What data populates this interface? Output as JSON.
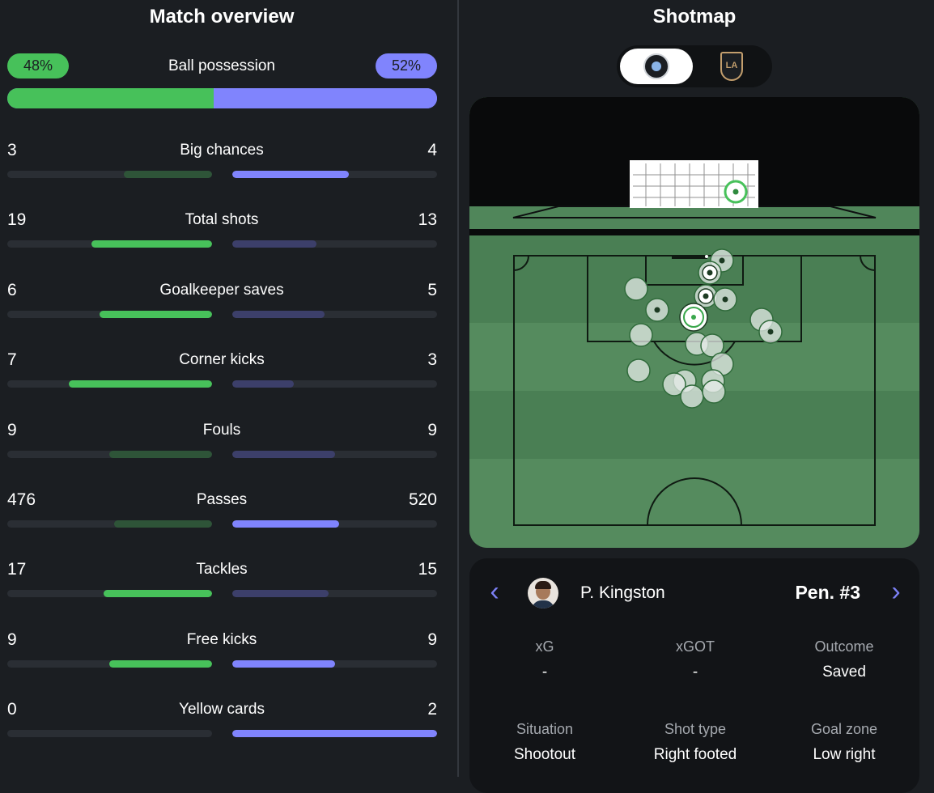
{
  "overview": {
    "title": "Match overview",
    "possession": {
      "label": "Ball possession",
      "home": "48%",
      "away": "52%",
      "home_fraction": 0.48
    },
    "stats": [
      {
        "label": "Big chances",
        "home": "3",
        "away": "4",
        "winner": "away",
        "home_fraction": 0.43,
        "away_fraction": 0.57
      },
      {
        "label": "Total shots",
        "home": "19",
        "away": "13",
        "winner": "home",
        "home_fraction": 0.59,
        "away_fraction": 0.41
      },
      {
        "label": "Goalkeeper saves",
        "home": "6",
        "away": "5",
        "winner": "home",
        "home_fraction": 0.55,
        "away_fraction": 0.45
      },
      {
        "label": "Corner kicks",
        "home": "7",
        "away": "3",
        "winner": "home",
        "home_fraction": 0.7,
        "away_fraction": 0.3
      },
      {
        "label": "Fouls",
        "home": "9",
        "away": "9",
        "winner": "none",
        "home_fraction": 0.5,
        "away_fraction": 0.5
      },
      {
        "label": "Passes",
        "home": "476",
        "away": "520",
        "winner": "away",
        "home_fraction": 0.48,
        "away_fraction": 0.52
      },
      {
        "label": "Tackles",
        "home": "17",
        "away": "15",
        "winner": "home",
        "home_fraction": 0.53,
        "away_fraction": 0.47
      },
      {
        "label": "Free kicks",
        "home": "9",
        "away": "9",
        "winner": "both",
        "home_fraction": 0.5,
        "away_fraction": 0.5
      },
      {
        "label": "Yellow cards",
        "home": "0",
        "away": "2",
        "winner": "away",
        "home_fraction": 0.0,
        "away_fraction": 1.0
      }
    ]
  },
  "shotmap": {
    "title": "Shotmap",
    "teams": {
      "home_icon": "home-team-crest-icon",
      "away_icon": "away-team-crest-icon",
      "away_crest_text": "LA",
      "selected": "home"
    },
    "selected_shot": {
      "player": "P. Kingston",
      "label": "Pen. #3",
      "xg_label": "xG",
      "xg": "-",
      "xgot_label": "xGOT",
      "xgot": "-",
      "outcome_label": "Outcome",
      "outcome": "Saved",
      "situation_label": "Situation",
      "situation": "Shootout",
      "shot_type_label": "Shot type",
      "shot_type": "Right footed",
      "goal_zone_label": "Goal zone",
      "goal_zone": "Low right"
    }
  },
  "colors": {
    "home": "#47c15a",
    "away": "#8084fd",
    "pitch": "#50865a",
    "background": "#1b1e22"
  }
}
